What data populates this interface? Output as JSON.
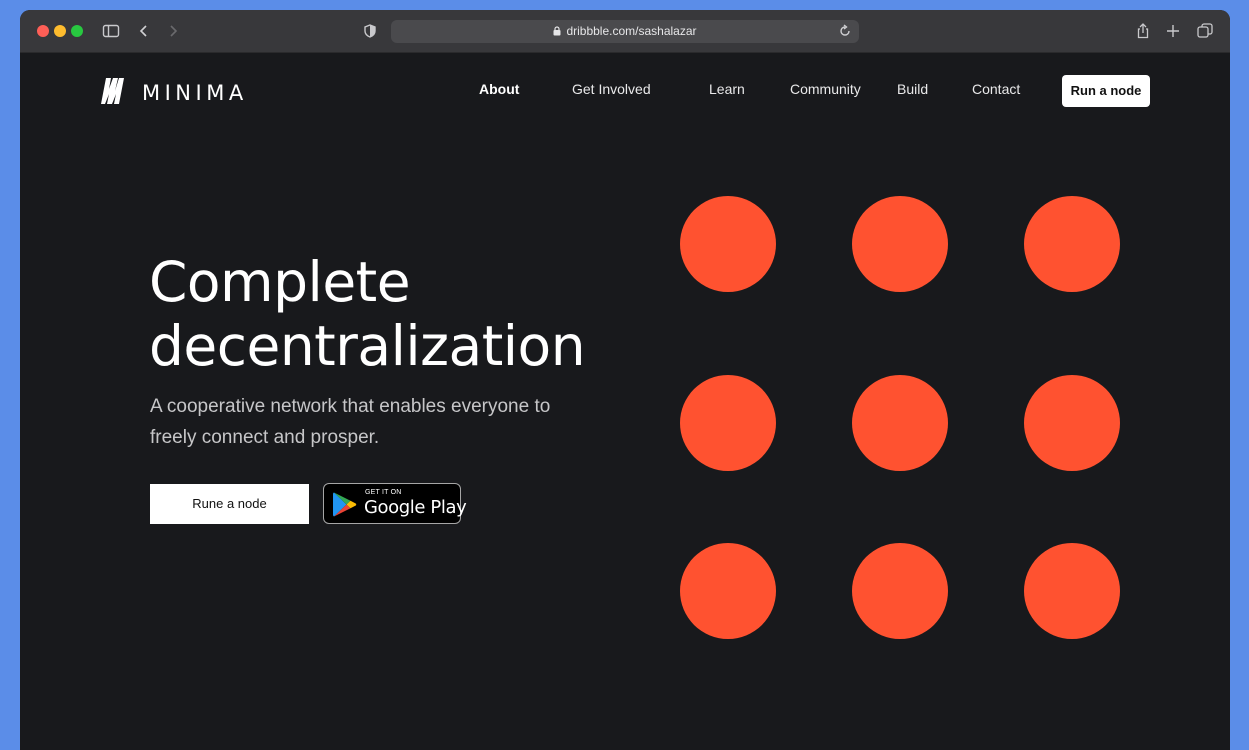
{
  "browser": {
    "url": "dribbble.com/sashalazar"
  },
  "site": {
    "logo_text": "MINIMA",
    "nav": [
      {
        "label": "About",
        "active": true
      },
      {
        "label": "Get Involved"
      },
      {
        "label": "Learn"
      },
      {
        "label": "Community"
      },
      {
        "label": "Build"
      },
      {
        "label": "Contact"
      }
    ],
    "nav_cta": "Run a node",
    "hero": {
      "title_line1": "Complete",
      "title_line2": "decentralization",
      "subtitle": "A cooperative network that enables everyone to freely connect and prosper.",
      "primary_button": "Rune a node",
      "store_badge": {
        "small": "GET IT ON",
        "big": "Google Play"
      }
    },
    "dots": {
      "color": "#ff5230",
      "rows": 3,
      "cols": 3
    }
  },
  "colors": {
    "background": "#18191c",
    "accent": "#ff5230",
    "desktop": "#5b8de8"
  }
}
